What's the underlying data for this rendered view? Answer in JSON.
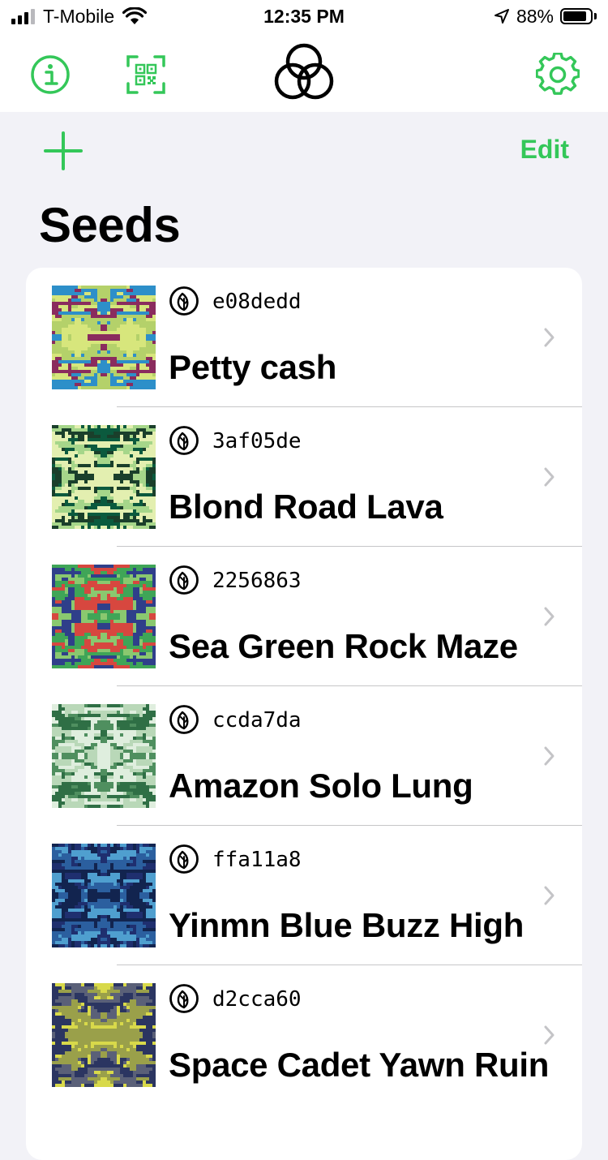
{
  "status_bar": {
    "carrier": "T-Mobile",
    "time": "12:35 PM",
    "battery_percent": "88%",
    "battery_level": 0.88,
    "signal_bars": 3
  },
  "nav": {
    "info_icon": "info-circle-icon",
    "qr_icon": "qr-code-scan-icon",
    "logo_icon": "interlocking-rings-logo",
    "settings_icon": "gear-icon"
  },
  "list_header": {
    "add_icon": "plus-icon",
    "edit_label": "Edit",
    "title": "Seeds"
  },
  "colors": {
    "accent": "#34c759",
    "background": "#f2f2f7",
    "card": "#ffffff"
  },
  "seeds": [
    {
      "id": "e08dedd",
      "name": "Petty cash",
      "palette": [
        "#8a2c5e",
        "#d7e67c",
        "#2d8fc9",
        "#b4d16a"
      ]
    },
    {
      "id": "3af05de",
      "name": "Blond Road Lava",
      "palette": [
        "#0b5a3e",
        "#e3efb0",
        "#a6d68a",
        "#1a3f2b"
      ]
    },
    {
      "id": "2256863",
      "name": "Sea Green Rock Maze",
      "palette": [
        "#d7473f",
        "#3fa557",
        "#2f3f8a",
        "#8ac86f"
      ]
    },
    {
      "id": "ccda7da",
      "name": "Amazon Solo Lung",
      "palette": [
        "#4f8f5f",
        "#b9d8b8",
        "#2f6f45",
        "#dfeede"
      ]
    },
    {
      "id": "ffa11a8",
      "name": "Yinmn Blue Buzz High",
      "palette": [
        "#1f2f6f",
        "#4f9fcf",
        "#12244f",
        "#2b5f9f"
      ]
    },
    {
      "id": "d2cca60",
      "name": "Space Cadet Yawn Ruin",
      "palette": [
        "#2b3561",
        "#d8d94a",
        "#5a6078",
        "#9aa04a"
      ]
    }
  ]
}
